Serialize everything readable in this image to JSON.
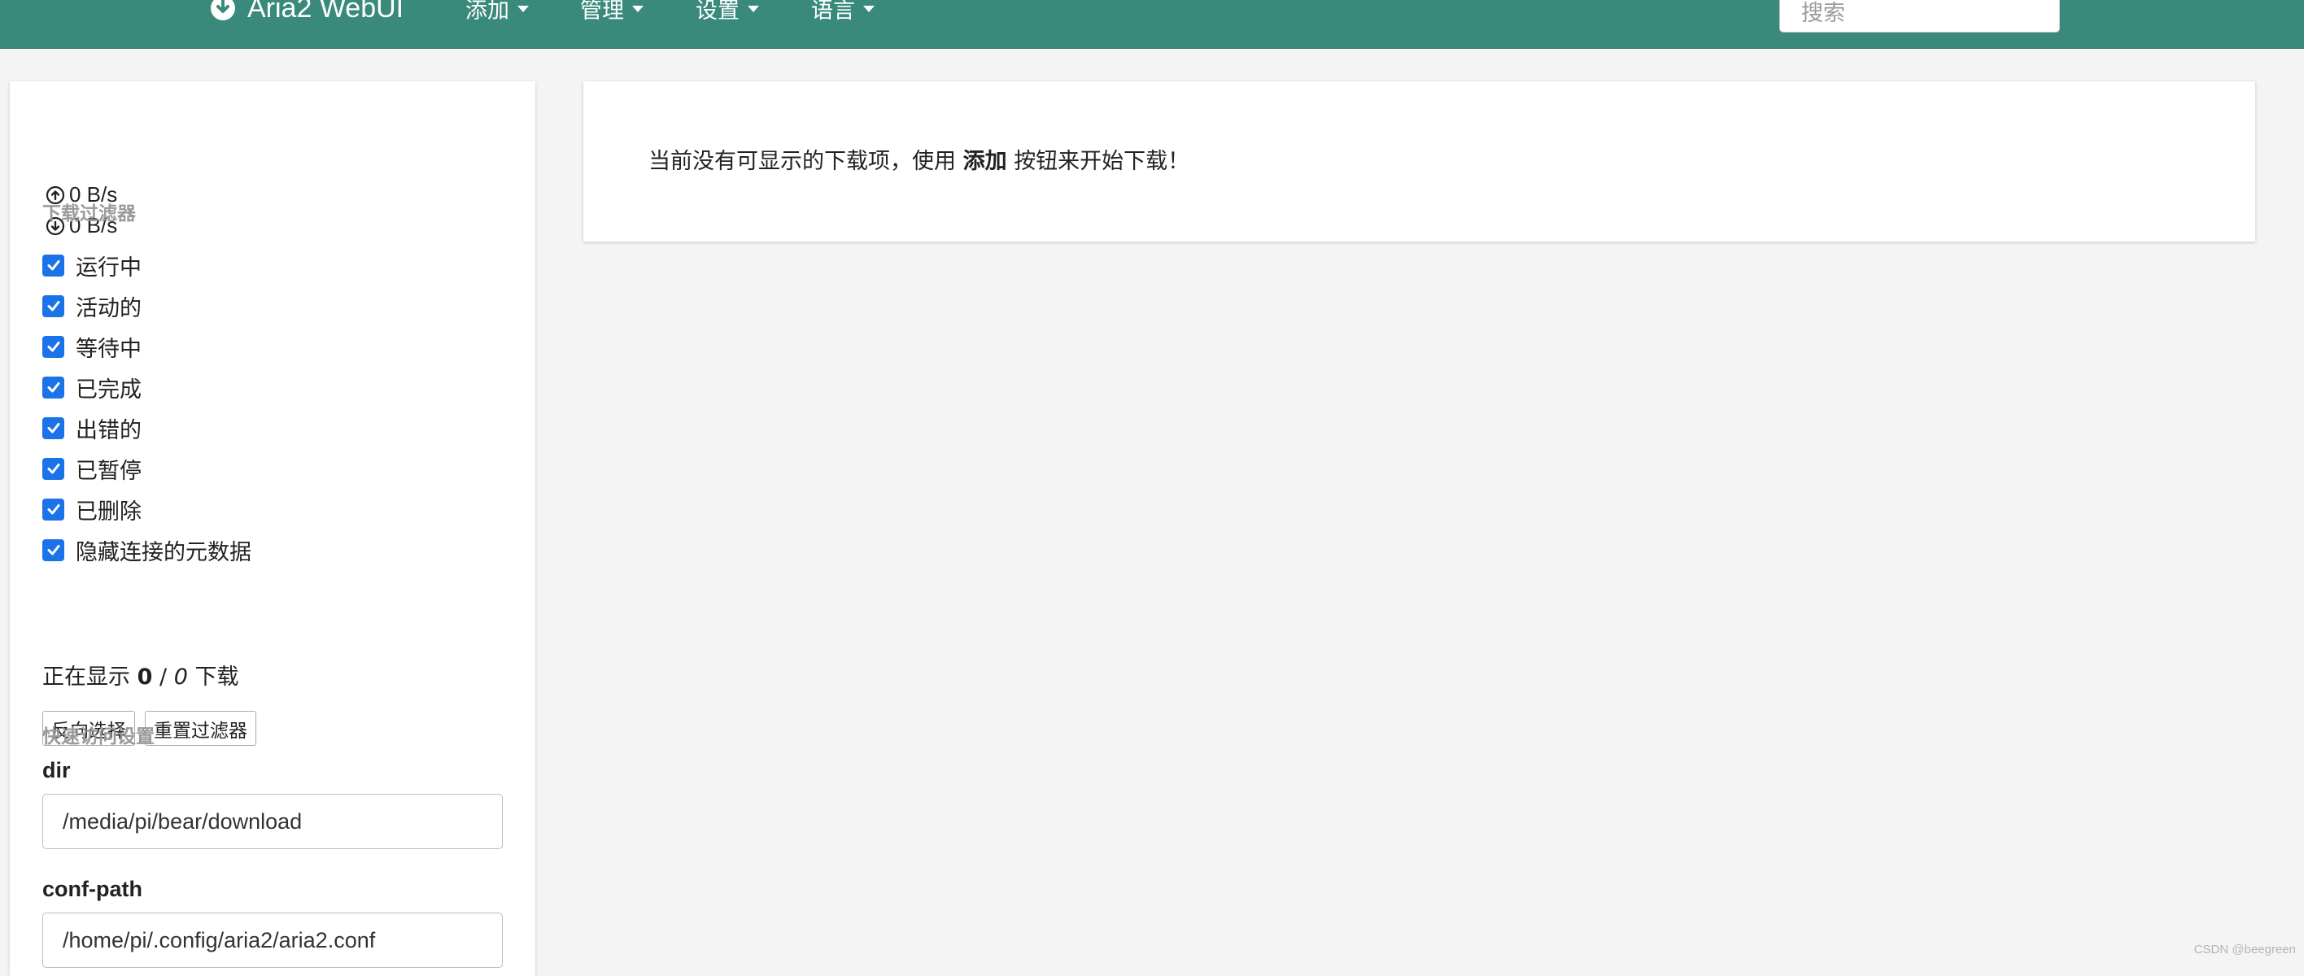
{
  "navbar": {
    "brand": "Aria2 WebUI",
    "menus": [
      {
        "label": "添加"
      },
      {
        "label": "管理"
      },
      {
        "label": "设置"
      },
      {
        "label": "语言"
      }
    ],
    "search_placeholder": "搜索",
    "background_color": "#3a8a7c"
  },
  "sidebar": {
    "upload_speed": "0 B/s",
    "download_speed": "0 B/s",
    "filters_title": "下载过滤器",
    "filters": [
      {
        "label": "运行中",
        "checked": true
      },
      {
        "label": "活动的",
        "checked": true
      },
      {
        "label": "等待中",
        "checked": true
      },
      {
        "label": "已完成",
        "checked": true
      },
      {
        "label": "出错的",
        "checked": true
      },
      {
        "label": "已暂停",
        "checked": true
      },
      {
        "label": "已删除",
        "checked": true
      },
      {
        "label": "隐藏连接的元数据",
        "checked": true
      }
    ],
    "count": {
      "prefix": "正在显示",
      "shown": "0",
      "separator": "/",
      "total": "0",
      "suffix": "下载"
    },
    "buttons": {
      "invert": "反向选择",
      "reset": "重置过滤器"
    },
    "quick_settings_title": "快速访问设置",
    "fields": [
      {
        "label": "dir",
        "value": "/media/pi/bear/download"
      },
      {
        "label": "conf-path",
        "value": "/home/pi/.config/aria2/aria2.conf"
      }
    ],
    "checkbox_color": "#1a73e8"
  },
  "main": {
    "empty_prefix": "当前没有可显示的下载项，使用",
    "empty_action": "添加",
    "empty_suffix": "按钮来开始下载！"
  },
  "watermark": "CSDN @beegreen"
}
